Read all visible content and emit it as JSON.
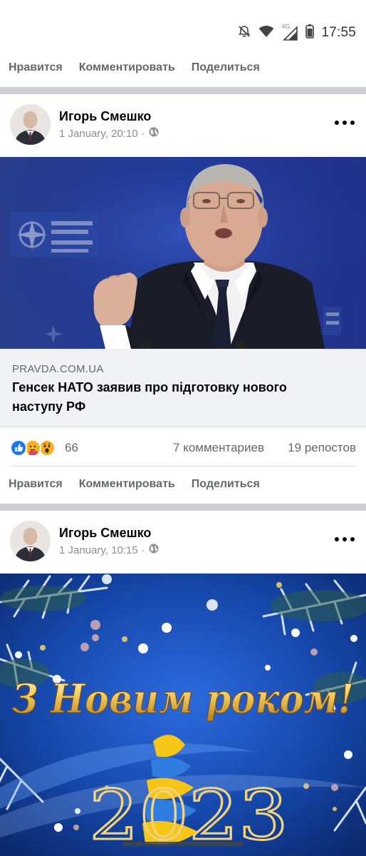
{
  "status_bar": {
    "time": "17:55",
    "network_label": "4G",
    "icons": [
      "muted-bell-icon",
      "wifi-icon",
      "cell-signal-icon",
      "battery-icon"
    ]
  },
  "top_actions": {
    "like": "Нравится",
    "comment": "Комментировать",
    "share": "Поделиться"
  },
  "posts": [
    {
      "author": "Игорь Смешко",
      "date": "1 January, 20:10",
      "separator": "·",
      "privacy_icon": "globe-icon",
      "image_content": "nato-press-photo",
      "link_preview": {
        "domain": "PRAVDA.COM.UA",
        "title": "Генсек НАТО заявив про підготовку нового наступу РФ"
      },
      "reactions": {
        "icons": [
          "like-reaction-icon",
          "care-reaction-icon",
          "wow-reaction-icon"
        ],
        "count": "66"
      },
      "comments": "7 комментариев",
      "shares": "19 репостов",
      "actions": {
        "like": "Нравится",
        "comment": "Комментировать",
        "share": "Поделиться"
      }
    },
    {
      "author": "Игорь Смешко",
      "date": "1 January, 10:15",
      "separator": "·",
      "privacy_icon": "globe-icon",
      "greeting_text": "З Новим роком!",
      "year_text": "2023"
    }
  ],
  "colors": {
    "secondary_text": "#65676b",
    "separator": "#ccd0d5",
    "like_blue": "#1877f2",
    "card_background": "#f0f2f5"
  }
}
